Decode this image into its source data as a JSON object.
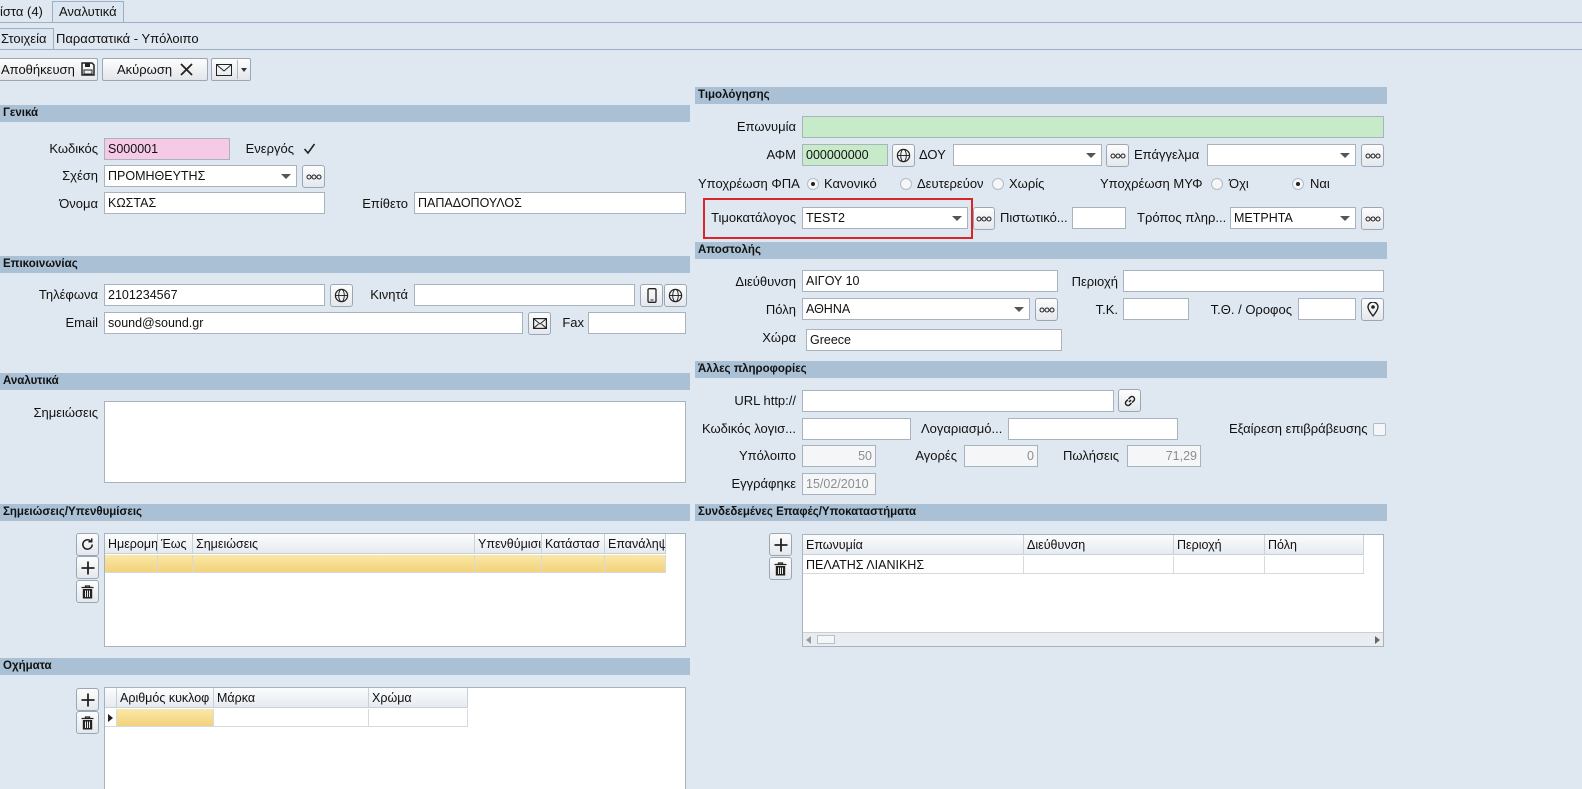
{
  "tabs": {
    "list": "ίστα (4)",
    "detail": "Αναλυτικά"
  },
  "subtabs": {
    "info": "Στοιχεία",
    "docs": "Παραστατικά - Υπόλοιπο"
  },
  "toolbar": {
    "save": "Αποθήκευση",
    "cancel": "Ακύρωση"
  },
  "general": {
    "header": "Γενικά",
    "code_label": "Κωδικός",
    "code_value": "S000001",
    "active_label": "Ενεργός",
    "relation_label": "Σχέση",
    "relation_value": "ΠΡΟΜΗΘΕΥΤΗΣ",
    "name_label": "Όνομα",
    "name_value": "ΚΩΣΤΑΣ",
    "surname_label": "Επίθετο",
    "surname_value": "ΠΑΠΑΔΟΠΟΥΛΟΣ"
  },
  "contact": {
    "header": "Επικοινωνίας",
    "phone_label": "Τηλέφωνα",
    "phone_value": "2101234567",
    "mobile_label": "Κινητά",
    "mobile_value": "",
    "email_label": "Email",
    "email_value": "sound@sound.gr",
    "fax_label": "Fax",
    "fax_value": ""
  },
  "details": {
    "header": "Αναλυτικά",
    "notes_label": "Σημειώσεις",
    "notes_value": ""
  },
  "reminders": {
    "header": "Σημειώσεις/Υπενθυμίσεις",
    "columns": [
      "Ημερομη",
      "Έως",
      "Σημειώσεις",
      "Υπενθύμισι",
      "Κατάστασ",
      "Επανάληψ"
    ]
  },
  "vehicles": {
    "header": "Οχήματα",
    "columns": [
      "Αριθμός κυκλοφ",
      "Μάρκα",
      "Χρώμα"
    ]
  },
  "billing": {
    "header": "Τιμολόγησης",
    "company_label": "Επωνυμία",
    "company_value": "",
    "vat_label": "ΑΦΜ",
    "vat_value": "000000000",
    "tax_office_label": "ΔΟΥ",
    "tax_office_value": "",
    "profession_label": "Επάγγελμα",
    "profession_value": "",
    "vat_obligation_label": "Υποχρέωση ΦΠΑ",
    "vat_options": [
      "Κανονικό",
      "Δευτερεύον",
      "Χωρίς"
    ],
    "myf_label": "Υποχρέωση ΜΥΦ",
    "myf_options": [
      "Όχι",
      "Ναι"
    ],
    "pricelist_label": "Τιμοκατάλογος",
    "pricelist_value": "TEST2",
    "credit_label": "Πιστωτικό...",
    "credit_value": "",
    "payment_label": "Τρόπος πληρ...",
    "payment_value": "ΜΕΤΡΗΤΑ",
    "highlight_color": "#d9262b"
  },
  "shipping": {
    "header": "Αποστολής",
    "address_label": "Διεύθυνση",
    "address_value": "ΑΙΓΟΥ 10",
    "area_label": "Περιοχή",
    "area_value": "",
    "city_label": "Πόλη",
    "city_value": "ΑΘΗΝΑ",
    "zip_label": "Τ.Κ.",
    "zip_value": "",
    "pobox_label": "Τ.Θ. / Οροφος",
    "pobox_value": "",
    "country_label": "Χώρα",
    "country_value": "Greece"
  },
  "other": {
    "header": "Άλλες πληροφορίες",
    "url_label": "URL http://",
    "url_value": "",
    "acc_code_label": "Κωδικός λογισ...",
    "acc_code_value": "",
    "account_label": "Λογαριασμό...",
    "account_value": "",
    "exempt_label": "Εξαίρεση επιβράβευσης",
    "balance_label": "Υπόλοιπο",
    "balance_value": "50",
    "purchases_label": "Αγορές",
    "purchases_value": "0",
    "sales_label": "Πωλήσεις",
    "sales_value": "71,29",
    "registered_label": "Εγγράφηκε",
    "registered_value": "15/02/2010"
  },
  "linked": {
    "header": "Συνδεδεμένες Επαφές/Υποκαταστήματα",
    "columns": [
      "Επωνυμία",
      "Διεύθυνση",
      "Περιοχή",
      "Πόλη"
    ],
    "rows": [
      [
        "ΠΕΛΑΤΗΣ ΛΙΑΝΙΚΗΣ",
        "",
        "",
        ""
      ]
    ]
  },
  "colors": {
    "code_bg": "#f6c9e6",
    "green_bg": "#c7eac8",
    "section_bg": "#a9c0d5",
    "page_bg": "#dfe8f1"
  }
}
